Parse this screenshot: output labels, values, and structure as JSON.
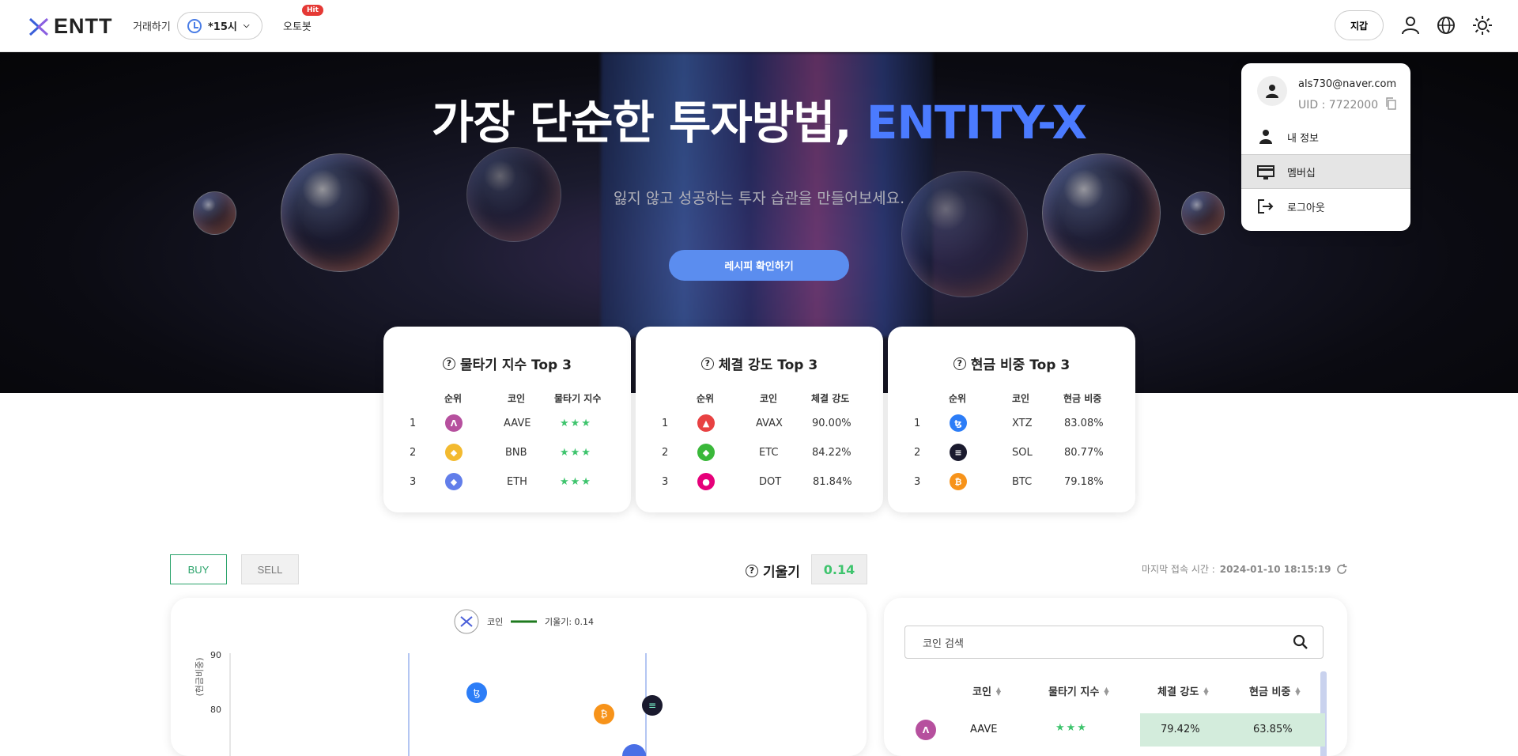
{
  "header": {
    "brand": "ENTT",
    "trade_label": "거래하기",
    "time_label": "*15시",
    "autobot_label": "오토봇",
    "hit_badge": "Hit",
    "wallet_label": "지갑"
  },
  "hero": {
    "title_main": "가장 단순한 투자방법, ",
    "title_accent": "ENTITY-X",
    "subtitle": "잃지 않고 성공하는 투자 습관을 만들어보세요.",
    "cta_label": "레시피 확인하기"
  },
  "cards": [
    {
      "title": "물타기 지수 Top 3",
      "headers": [
        "순위",
        "코인",
        "물타기 지수"
      ],
      "rows": [
        {
          "rank": "1",
          "coin": "AAVE",
          "value": "★★★",
          "icon": "aave-icon",
          "color": "#b6509e"
        },
        {
          "rank": "2",
          "coin": "BNB",
          "value": "★★★",
          "icon": "bnb-icon",
          "color": "#f3ba2f"
        },
        {
          "rank": "3",
          "coin": "ETH",
          "value": "★★★",
          "icon": "eth-icon",
          "color": "#627eea"
        }
      ]
    },
    {
      "title": "체결 강도 Top 3",
      "headers": [
        "순위",
        "코인",
        "체결 강도"
      ],
      "rows": [
        {
          "rank": "1",
          "coin": "AVAX",
          "value": "90.00%",
          "icon": "avax-icon",
          "color": "#e84142"
        },
        {
          "rank": "2",
          "coin": "ETC",
          "value": "84.22%",
          "icon": "etc-icon",
          "color": "#3ab83a"
        },
        {
          "rank": "3",
          "coin": "DOT",
          "value": "81.84%",
          "icon": "dot-icon",
          "color": "#e6007a"
        }
      ]
    },
    {
      "title": "현금 비중 Top 3",
      "headers": [
        "순위",
        "코인",
        "현금 비중"
      ],
      "rows": [
        {
          "rank": "1",
          "coin": "XTZ",
          "value": "83.08%",
          "icon": "xtz-icon",
          "color": "#2c7df7"
        },
        {
          "rank": "2",
          "coin": "SOL",
          "value": "80.77%",
          "icon": "sol-icon",
          "color": "#1a1a2e"
        },
        {
          "rank": "3",
          "coin": "BTC",
          "value": "79.18%",
          "icon": "btc-icon",
          "color": "#f7931a"
        }
      ]
    }
  ],
  "controls": {
    "buy_label": "BUY",
    "sell_label": "SELL",
    "slope_label": "기울기",
    "slope_value": "0.14",
    "last_access_label": "마지막 접속 시간 : ",
    "last_access_value": "2024-01-10 18:15:19"
  },
  "chart": {
    "legend_coin": "코인",
    "legend_slope": "기울기: 0.14",
    "ylabel": "(현금비중)",
    "yticks": [
      "90",
      "80"
    ]
  },
  "chart_data": {
    "type": "scatter",
    "title": "",
    "xlabel": "",
    "ylabel": "(현금비중)",
    "series": [
      {
        "values": [
          {
            "coin": "XTZ",
            "y": 83.08
          },
          {
            "coin": "SOL",
            "y": 80.77
          },
          {
            "coin": "BTC",
            "y": 79.18
          }
        ]
      }
    ],
    "yticks": [
      90,
      80
    ],
    "legend": [
      "코인",
      "기울기: 0.14"
    ],
    "slope": 0.14
  },
  "table": {
    "search_placeholder": "코인 검색",
    "headers": [
      "코인",
      "물타기 지수",
      "체결 강도",
      "현금 비중"
    ],
    "rows": [
      {
        "coin": "AAVE",
        "water": "★★★",
        "strength": "79.42%",
        "cash": "63.85%"
      }
    ]
  },
  "dropdown": {
    "email": "als730@naver.com",
    "uid": "UID : 7722000",
    "items": [
      "내 정보",
      "멤버십",
      "로그아웃"
    ]
  },
  "colors": {
    "accent": "#4b7bff",
    "buy": "#2aa36a",
    "positive": "#3ec46d",
    "highlight_cell": "#d3ecdc"
  }
}
